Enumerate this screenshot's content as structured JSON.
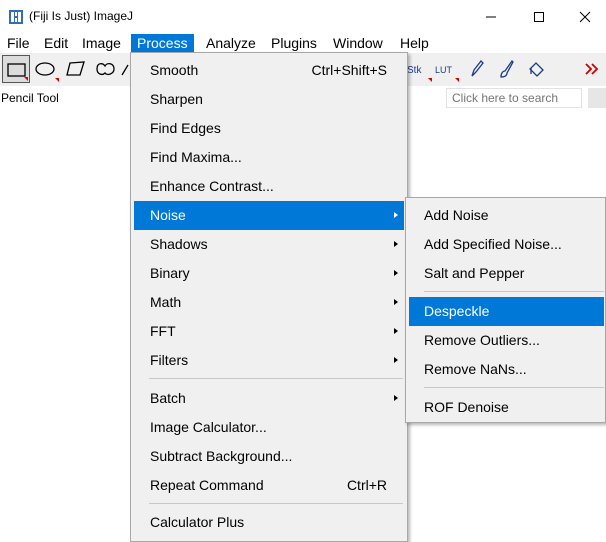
{
  "window": {
    "title": "(Fiji Is Just) ImageJ",
    "controls": [
      "minimize",
      "maximize",
      "close"
    ]
  },
  "menubar": {
    "items": [
      "File",
      "Edit",
      "Image",
      "Process",
      "Analyze",
      "Plugins",
      "Window",
      "Help"
    ],
    "active": "Process"
  },
  "toolbar": {
    "tools": [
      "rectangle-tool-icon",
      "oval-tool-icon",
      "polygon-tool-icon",
      "freehand-tool-icon",
      "line-tool-icon"
    ],
    "right_labels": {
      "stk": "Stk",
      "lut": "LUT"
    },
    "right_tools": [
      "pencil-tool-icon",
      "brush-tool-icon",
      "flood-fill-tool-icon",
      "more-tools-icon"
    ],
    "accent": "#cc0000"
  },
  "status": {
    "text": "Pencil Tool",
    "search_placeholder": "Click here to search"
  },
  "process_menu": {
    "items": [
      {
        "label": "Smooth",
        "shortcut": "Ctrl+Shift+S"
      },
      {
        "label": "Sharpen"
      },
      {
        "label": "Find Edges"
      },
      {
        "label": "Find Maxima..."
      },
      {
        "label": "Enhance Contrast..."
      },
      {
        "label": "Noise",
        "submenu": true,
        "highlighted": true
      },
      {
        "label": "Shadows",
        "submenu": true
      },
      {
        "label": "Binary",
        "submenu": true
      },
      {
        "label": "Math",
        "submenu": true
      },
      {
        "label": "FFT",
        "submenu": true
      },
      {
        "label": "Filters",
        "submenu": true
      },
      {
        "label": "Batch",
        "submenu": true
      },
      {
        "label": "Image Calculator..."
      },
      {
        "label": "Subtract Background..."
      },
      {
        "label": "Repeat Command",
        "shortcut": "Ctrl+R"
      },
      {
        "label": "Calculator Plus"
      }
    ]
  },
  "noise_menu": {
    "items": [
      {
        "label": "Add Noise"
      },
      {
        "label": "Add Specified Noise..."
      },
      {
        "label": "Salt and Pepper"
      },
      {
        "label": "Despeckle",
        "highlighted": true
      },
      {
        "label": "Remove Outliers..."
      },
      {
        "label": "Remove NaNs..."
      },
      {
        "label": "ROF Denoise"
      }
    ]
  },
  "colors": {
    "highlight": "#0078d7",
    "menu_bg": "#f0f0f0",
    "toolbar_bg": "#f0f0f0"
  }
}
